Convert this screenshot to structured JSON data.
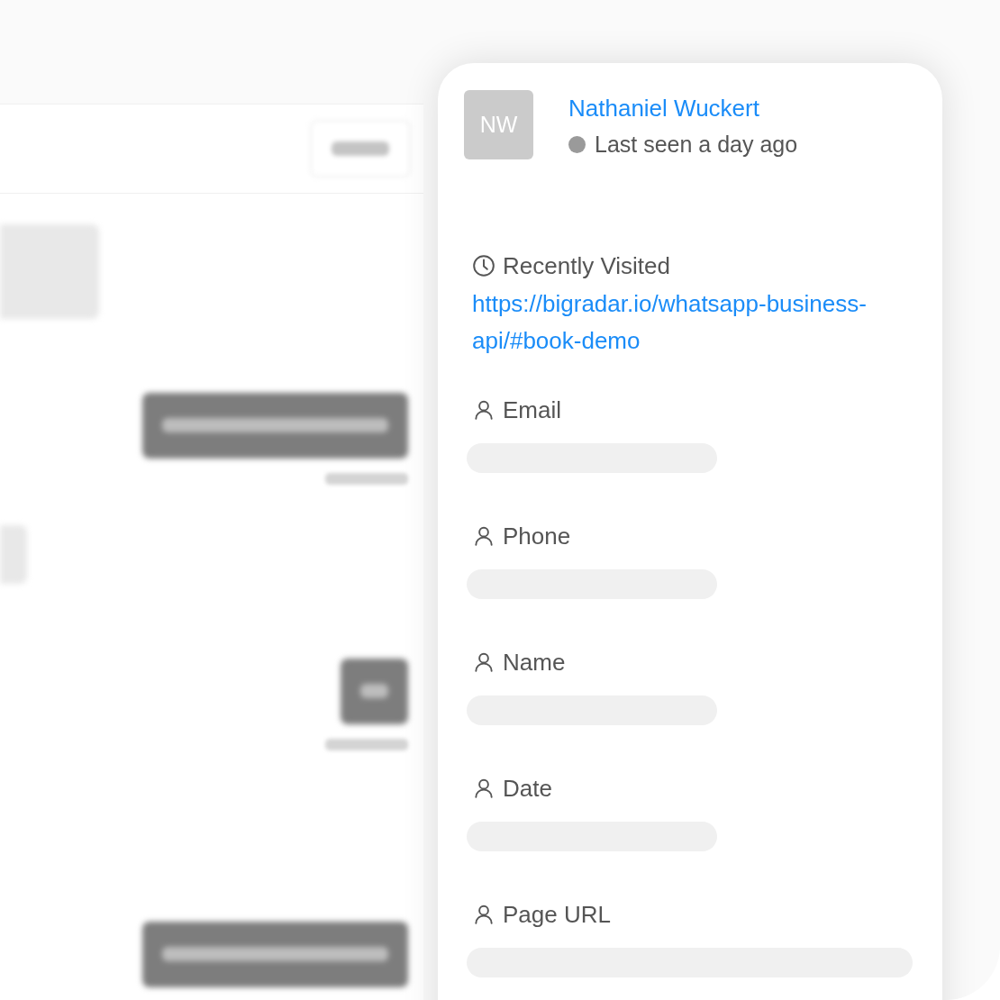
{
  "chat": {
    "messages": [
      {
        "kind": "incoming"
      },
      {
        "kind": "outgoing_long",
        "timestamp": true
      },
      {
        "kind": "incoming_small"
      },
      {
        "kind": "outgoing_short",
        "timestamp": true
      },
      {
        "kind": "outgoing_long",
        "timestamp": false
      }
    ]
  },
  "contact": {
    "initials": "NW",
    "name": "Nathaniel Wuckert",
    "status": "Last seen a day ago",
    "online": false,
    "recently_visited": {
      "label": "Recently Visited",
      "url": "https://bigradar.io/whatsapp-business-api/#book-demo"
    },
    "fields": [
      {
        "label": "Email",
        "kind": "short"
      },
      {
        "label": "Phone",
        "kind": "short"
      },
      {
        "label": "Name",
        "kind": "short"
      },
      {
        "label": "Date",
        "kind": "short"
      },
      {
        "label": "Page URL",
        "kind": "wide"
      }
    ]
  }
}
